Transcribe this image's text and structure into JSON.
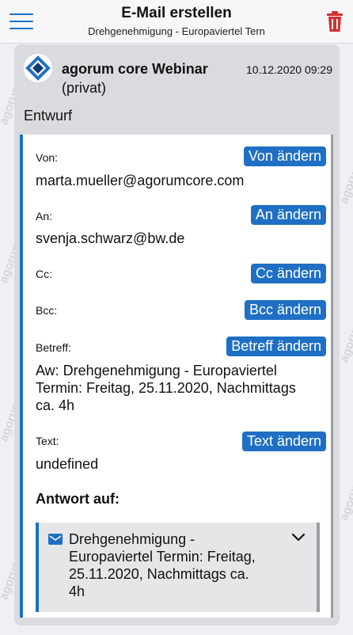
{
  "header": {
    "title": "E-Mail erstellen",
    "subtitle": "Drehgenehmigung - Europaviertel Tern"
  },
  "card": {
    "sender": "agorum core Webinar",
    "sender_sub": "(privat)",
    "date": "10.12.2020 09:29",
    "status": "Entwurf"
  },
  "fields": {
    "from": {
      "label": "Von:",
      "value": "marta.mueller@agorumcore.com",
      "button": "Von ändern"
    },
    "to": {
      "label": "An:",
      "value": "svenja.schwarz@bw.de",
      "button": "An ändern"
    },
    "cc": {
      "label": "Cc:",
      "button": "Cc ändern"
    },
    "bcc": {
      "label": "Bcc:",
      "button": "Bcc ändern"
    },
    "subject": {
      "label": "Betreff:",
      "value_line1": "Aw: Drehgenehmigung - Europaviertel",
      "value_line2": "Termin: Freitag, 25.11.2020, Nachmittags",
      "value_line3": "ca. 4h",
      "button": "Betreff ändern"
    },
    "text": {
      "label": "Text:",
      "value": "undefined",
      "button": "Text ändern"
    }
  },
  "reply": {
    "title": "Antwort auf:",
    "line1": "Drehgenehmigung -",
    "line2": "Europaviertel Termin: Freitag,",
    "line3": "25.11.2020, Nachmittags ca.",
    "line4": "4h"
  },
  "colors": {
    "accent": "#1f6fc4",
    "delete": "#d32f2f"
  },
  "icons": {
    "menu": "hamburger-icon",
    "delete": "trash-icon",
    "logo": "agorum-logo-icon",
    "mail": "mail-icon",
    "expand": "chevron-down-icon"
  }
}
